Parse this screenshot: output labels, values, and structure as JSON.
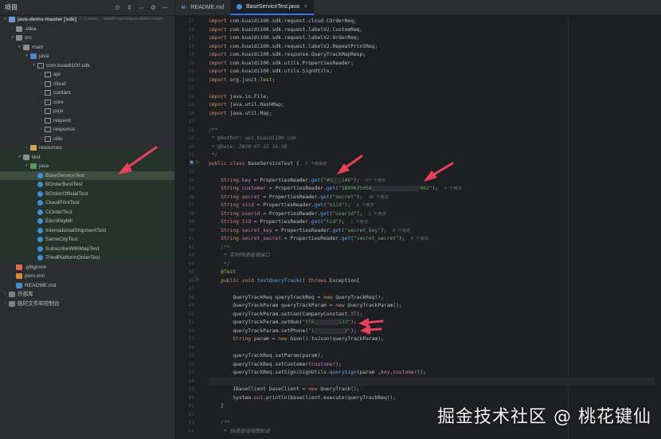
{
  "project": {
    "title": "项目",
    "toolbar_icons": [
      "target-icon",
      "expand-icon",
      "collapse-icon",
      "settings-icon",
      "minimize-icon"
    ],
    "toolbar_glyphs": [
      "⊙",
      "⇕",
      "⇔",
      "⚙",
      "—"
    ],
    "tree": [
      {
        "label": "java-demo-master [sdk]",
        "extra": "C:\\Users\\... \\IdeaProjects\\java-demo-maste",
        "indent": 0,
        "arrow": "▾",
        "icon": "module"
      },
      {
        "label": ".idea",
        "indent": 1,
        "arrow": "›",
        "icon": "folder"
      },
      {
        "label": "src",
        "indent": 1,
        "arrow": "▾",
        "icon": "folder"
      },
      {
        "label": "main",
        "indent": 2,
        "arrow": "▾",
        "icon": "folder"
      },
      {
        "label": "java",
        "indent": 3,
        "arrow": "▾",
        "icon": "folder-src"
      },
      {
        "label": "com.kuaidi100.sdk",
        "indent": 4,
        "arrow": "▾",
        "icon": "pkg"
      },
      {
        "label": "api",
        "indent": 5,
        "arrow": "›",
        "icon": "pkg"
      },
      {
        "label": "cloud",
        "indent": 5,
        "arrow": "›",
        "icon": "pkg"
      },
      {
        "label": "contant",
        "indent": 5,
        "arrow": "›",
        "icon": "pkg"
      },
      {
        "label": "core",
        "indent": 5,
        "arrow": "›",
        "icon": "pkg"
      },
      {
        "label": "pojo",
        "indent": 5,
        "arrow": "›",
        "icon": "pkg"
      },
      {
        "label": "request",
        "indent": 5,
        "arrow": "›",
        "icon": "pkg"
      },
      {
        "label": "response",
        "indent": 5,
        "arrow": "›",
        "icon": "pkg"
      },
      {
        "label": "utils",
        "indent": 5,
        "arrow": "›",
        "icon": "pkg"
      },
      {
        "label": "resources",
        "indent": 3,
        "arrow": "›",
        "icon": "folder-res"
      },
      {
        "label": "test",
        "indent": 2,
        "arrow": "▾",
        "icon": "folder"
      },
      {
        "label": "java",
        "indent": 3,
        "arrow": "▾",
        "icon": "folder-test"
      },
      {
        "label": "BaseServiceTest",
        "indent": 4,
        "arrow": "",
        "icon": "cls",
        "selected": true
      },
      {
        "label": "BOrderBestTest",
        "indent": 4,
        "arrow": "",
        "icon": "cls"
      },
      {
        "label": "BOrderOfficialTest",
        "indent": 4,
        "arrow": "",
        "icon": "cls"
      },
      {
        "label": "CloudPrintTest",
        "indent": 4,
        "arrow": "",
        "icon": "cls"
      },
      {
        "label": "COrderTest",
        "indent": 4,
        "arrow": "",
        "icon": "cls"
      },
      {
        "label": "ElecWaybill",
        "indent": 4,
        "arrow": "",
        "icon": "cls"
      },
      {
        "label": "InternationalShipmentTest",
        "indent": 4,
        "arrow": "",
        "icon": "cls"
      },
      {
        "label": "SameCityTest",
        "indent": 4,
        "arrow": "",
        "icon": "cls"
      },
      {
        "label": "SubscribeWithMapTest",
        "indent": 4,
        "arrow": "",
        "icon": "cls"
      },
      {
        "label": "ThirdPlatformOrderTest",
        "indent": 4,
        "arrow": "",
        "icon": "cls"
      },
      {
        "label": ".gitignore",
        "indent": 1,
        "arrow": "",
        "icon": "git"
      },
      {
        "label": "pom.xml",
        "indent": 1,
        "arrow": "",
        "icon": "xml"
      },
      {
        "label": "README.md",
        "indent": 1,
        "arrow": "",
        "icon": "md"
      },
      {
        "label": "外部库",
        "indent": 0,
        "arrow": "›",
        "icon": "lib"
      },
      {
        "label": "临时文件和控制台",
        "indent": 0,
        "arrow": "›",
        "icon": "lib"
      }
    ]
  },
  "tabs": [
    {
      "icon": "M↓",
      "label": "README.md",
      "active": false
    },
    {
      "icon": "java",
      "label": "BaseServiceTest.java",
      "active": true
    }
  ],
  "code_lines": [
    {
      "n": "15",
      "parts": [
        [
          "kw",
          "import "
        ],
        [
          "",
          "com.kuaidi100.sdk.request.cloud.COrderReq;"
        ]
      ]
    },
    {
      "n": "16",
      "parts": [
        [
          "kw",
          "import "
        ],
        [
          "",
          "com.kuaidi100.sdk.request.labelV2.CustomReq;"
        ]
      ]
    },
    {
      "n": "17",
      "parts": [
        [
          "kw",
          "import "
        ],
        [
          "",
          "com.kuaidi100.sdk.request.labelV2.OrderReq;"
        ]
      ]
    },
    {
      "n": "18",
      "parts": [
        [
          "kw",
          "import "
        ],
        [
          "",
          "com.kuaidi100.sdk.request.labelV2.RepeatPrintReq;"
        ]
      ]
    },
    {
      "n": "19",
      "parts": [
        [
          "kw",
          "import "
        ],
        [
          "",
          "com.kuaidi100.sdk.response.QueryTrackMapResp;"
        ]
      ]
    },
    {
      "n": "20",
      "parts": [
        [
          "kw",
          "import "
        ],
        [
          "",
          "com.kuaidi100.sdk.utils.PropertiesReader;"
        ]
      ]
    },
    {
      "n": "21",
      "parts": [
        [
          "kw",
          "import "
        ],
        [
          "",
          "com.kuaidi100.sdk.utils.SignUtils;"
        ]
      ]
    },
    {
      "n": "22",
      "parts": [
        [
          "kw",
          "import "
        ],
        [
          "",
          "org.junit."
        ],
        [
          "ann",
          "Test"
        ],
        [
          "",
          ";"
        ]
      ]
    },
    {
      "n": "23",
      "parts": []
    },
    {
      "n": "24",
      "parts": [
        [
          "kw",
          "import "
        ],
        [
          "",
          "java.io.File;"
        ]
      ]
    },
    {
      "n": "25",
      "parts": [
        [
          "kw",
          "import "
        ],
        [
          "",
          "java.util.HashMap;"
        ]
      ]
    },
    {
      "n": "26",
      "parts": [
        [
          "kw",
          "import "
        ],
        [
          "",
          "java.util.Map;"
        ]
      ]
    },
    {
      "n": "27",
      "parts": []
    },
    {
      "n": "28",
      "parts": [
        [
          "cmt",
          "/**"
        ]
      ]
    },
    {
      "n": "29",
      "parts": [
        [
          "cmt",
          " * @Author: api.kuaidi100.com"
        ]
      ]
    },
    {
      "n": "30",
      "parts": [
        [
          "cmt",
          " * @Date: 2020-07-15 16:38"
        ]
      ]
    },
    {
      "n": "31",
      "parts": [
        [
          "cmt",
          " */"
        ]
      ]
    },
    {
      "n": "32",
      "parts": [
        [
          "kw",
          "public class "
        ],
        [
          "",
          "BaseServiceTest {  "
        ],
        [
          "hint",
          "6 个继承者"
        ]
      ]
    },
    {
      "n": "33",
      "parts": []
    },
    {
      "n": "34",
      "parts": [
        [
          "kw",
          "    String "
        ],
        [
          "fld",
          "key"
        ],
        [
          "",
          " = PropertiesReader."
        ],
        [
          "fn",
          "get"
        ],
        [
          "",
          "("
        ],
        [
          "str",
          "\"#5"
        ],
        [
          "redact",
          "___"
        ],
        [
          "str",
          "146\""
        ],
        [
          "",
          ");  "
        ],
        [
          "hint",
          "67 个用法"
        ]
      ]
    },
    {
      "n": "35",
      "parts": [
        [
          "kw",
          "    String "
        ],
        [
          "fld",
          "customer"
        ],
        [
          "",
          " = PropertiesReader."
        ],
        [
          "fn",
          "get"
        ],
        [
          "",
          "("
        ],
        [
          "str",
          "\"5B99635058"
        ],
        [
          "redact",
          "________________"
        ],
        [
          "str",
          "062\""
        ],
        [
          "",
          ");  "
        ],
        [
          "hint",
          "4 个用法"
        ]
      ]
    },
    {
      "n": "36",
      "parts": [
        [
          "kw",
          "    String "
        ],
        [
          "fld",
          "secret"
        ],
        [
          "",
          " = PropertiesReader."
        ],
        [
          "fn",
          "get"
        ],
        [
          "",
          "("
        ],
        [
          "str",
          "\"secret\""
        ],
        [
          "",
          ");  "
        ],
        [
          "hint",
          "40 个用法"
        ]
      ]
    },
    {
      "n": "37",
      "parts": [
        [
          "kw",
          "    String "
        ],
        [
          "fld",
          "siid"
        ],
        [
          "",
          " = PropertiesReader."
        ],
        [
          "fn",
          "get"
        ],
        [
          "",
          "("
        ],
        [
          "str",
          "\"siid\""
        ],
        [
          "",
          ");  "
        ],
        [
          "hint",
          "6 个用法"
        ]
      ]
    },
    {
      "n": "38",
      "parts": [
        [
          "kw",
          "    String "
        ],
        [
          "fld",
          "userid"
        ],
        [
          "",
          " = PropertiesReader."
        ],
        [
          "fn",
          "get"
        ],
        [
          "",
          "("
        ],
        [
          "str",
          "\"userid\""
        ],
        [
          "",
          ");  "
        ],
        [
          "hint",
          "2 个用法"
        ]
      ]
    },
    {
      "n": "39",
      "parts": [
        [
          "kw",
          "    String "
        ],
        [
          "fld",
          "tid"
        ],
        [
          "",
          " = PropertiesReader."
        ],
        [
          "fn",
          "get"
        ],
        [
          "",
          "("
        ],
        [
          "str",
          "\"tid\""
        ],
        [
          "",
          ");  "
        ],
        [
          "hint",
          "1 个用法"
        ]
      ]
    },
    {
      "n": "40",
      "parts": [
        [
          "kw",
          "    String "
        ],
        [
          "fld",
          "secret_key"
        ],
        [
          "",
          " = PropertiesReader."
        ],
        [
          "fn",
          "get"
        ],
        [
          "",
          "("
        ],
        [
          "str",
          "\"secret_key\""
        ],
        [
          "",
          ");  "
        ],
        [
          "hint",
          "6 个用法"
        ]
      ]
    },
    {
      "n": "41",
      "parts": [
        [
          "kw",
          "    String "
        ],
        [
          "fld",
          "secret_secret"
        ],
        [
          "",
          " = PropertiesReader."
        ],
        [
          "fn",
          "get"
        ],
        [
          "",
          "("
        ],
        [
          "str",
          "\"secret_secret\""
        ],
        [
          "",
          ");  "
        ],
        [
          "hint",
          "6 个用法"
        ]
      ]
    },
    {
      "n": "42",
      "parts": [
        [
          "cmt",
          "    /**"
        ]
      ]
    },
    {
      "n": "43",
      "parts": [
        [
          "cmt",
          "     * 实时快递查询接口"
        ]
      ]
    },
    {
      "n": "44",
      "parts": [
        [
          "cmt",
          "     */"
        ]
      ]
    },
    {
      "n": "45",
      "parts": [
        [
          "ann",
          "    @Test"
        ]
      ]
    },
    {
      "n": "46",
      "parts": [
        [
          "kw",
          "    public void "
        ],
        [
          "fn",
          "testQueryTrack"
        ],
        [
          "",
          "() "
        ],
        [
          "kw",
          "throws "
        ],
        [
          "",
          "Exception{"
        ]
      ]
    },
    {
      "n": "47",
      "parts": []
    },
    {
      "n": "48",
      "parts": [
        [
          "",
          "        QueryTrackReq queryTrackReq = "
        ],
        [
          "kw",
          "new "
        ],
        [
          "",
          "QueryTrackReq();"
        ]
      ]
    },
    {
      "n": "49",
      "parts": [
        [
          "",
          "        QueryTrackParam queryTrackParam = "
        ],
        [
          "kw",
          "new "
        ],
        [
          "",
          "QueryTrackParam();"
        ]
      ]
    },
    {
      "n": "50",
      "parts": [
        [
          "",
          "        queryTrackParam.setCom(CompanyConstant."
        ],
        [
          "fld",
          "YT"
        ],
        [
          "",
          ");"
        ]
      ]
    },
    {
      "n": "51",
      "parts": [
        [
          "",
          "        queryTrackParam.setNum("
        ],
        [
          "str",
          "\"YT6"
        ],
        [
          "redact",
          "________"
        ],
        [
          "str",
          "133\""
        ],
        [
          "",
          ");"
        ]
      ]
    },
    {
      "n": "52",
      "parts": [
        [
          "",
          "        queryTrackParam.setPhone("
        ],
        [
          "str",
          "\"1"
        ],
        [
          "redact",
          "__________"
        ],
        [
          "str",
          "2\""
        ],
        [
          "",
          ");"
        ]
      ]
    },
    {
      "n": "53",
      "parts": [
        [
          "kw",
          "        String "
        ],
        [
          "",
          "param = "
        ],
        [
          "kw",
          "new "
        ],
        [
          "",
          "Gson().toJson(queryTrackParam);"
        ]
      ]
    },
    {
      "n": "54",
      "parts": []
    },
    {
      "n": "55",
      "parts": [
        [
          "",
          "        queryTrackReq.setParam(param);"
        ]
      ]
    },
    {
      "n": "56",
      "parts": [
        [
          "",
          "        queryTrackReq.setCustomer("
        ],
        [
          "fld",
          "customer"
        ],
        [
          "",
          ");"
        ]
      ]
    },
    {
      "n": "57",
      "parts": [
        [
          "",
          "        queryTrackReq.setSign(SignUtils."
        ],
        [
          "fn",
          "querySign"
        ],
        [
          "",
          "(param ,"
        ],
        [
          "fld",
          "key"
        ],
        [
          "",
          ","
        ],
        [
          "fld",
          "customer"
        ],
        [
          "",
          "));"
        ]
      ]
    },
    {
      "n": "58",
      "parts": []
    },
    {
      "n": "59",
      "parts": [
        [
          "",
          "        IBaseClient baseClient = "
        ],
        [
          "kw",
          "new "
        ],
        [
          "",
          "QueryTrack();"
        ]
      ]
    },
    {
      "n": "60",
      "parts": [
        [
          "",
          "        System."
        ],
        [
          "fld",
          "out"
        ],
        [
          "",
          ".println(baseClient.execute(queryTrackReq));"
        ]
      ]
    },
    {
      "n": "61",
      "parts": [
        [
          "",
          "    }"
        ]
      ]
    },
    {
      "n": "62",
      "parts": []
    },
    {
      "n": "63",
      "parts": [
        [
          "cmt",
          "    /**"
        ]
      ]
    },
    {
      "n": "64",
      "parts": [
        [
          "cmt",
          "     * 快递查询地图轨迹"
        ]
      ]
    }
  ],
  "colors": {
    "accent": "#3574f0",
    "arrow": "#e8425a"
  },
  "watermark": "掘金技术社区 @ 桃花键仙"
}
